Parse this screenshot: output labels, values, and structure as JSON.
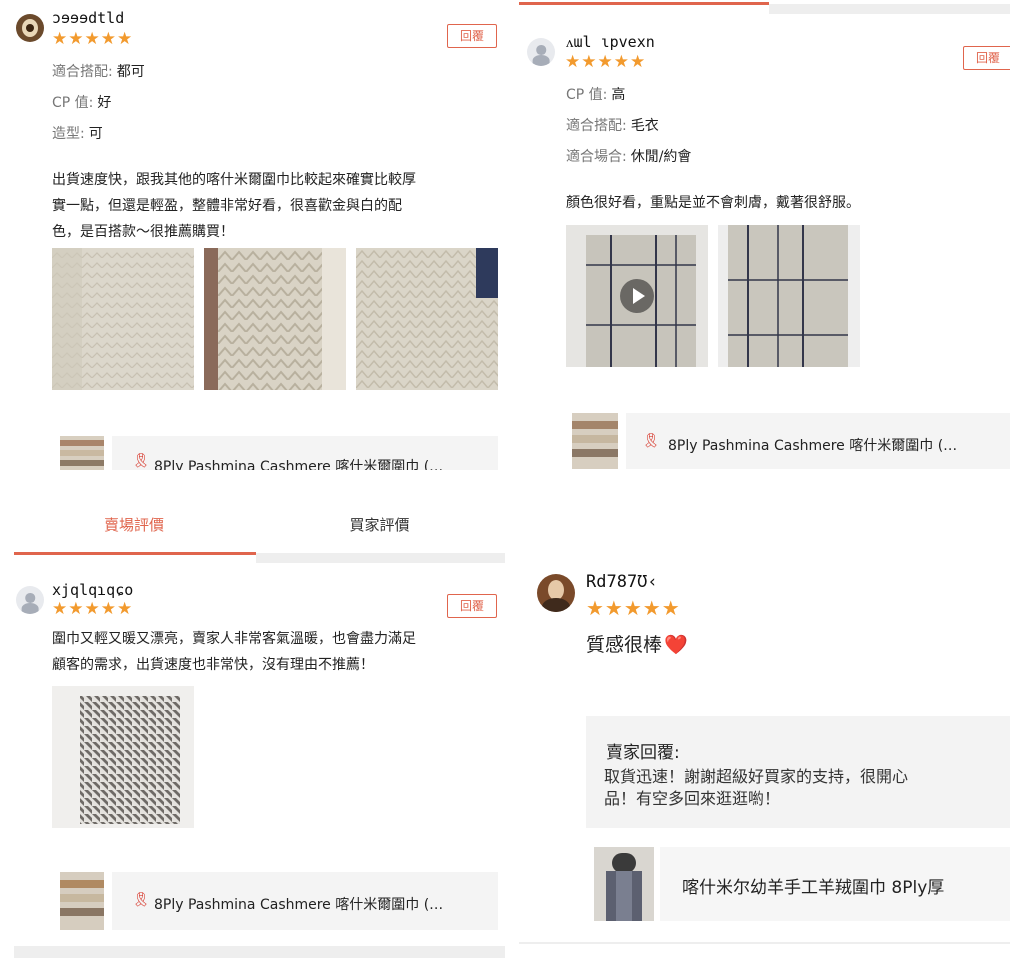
{
  "reply_label": "回覆",
  "star_glyphs": "★★★★★",
  "accent_color": "#e0654d",
  "star_color": "#f29a2e",
  "review1": {
    "username": "ɔɘɘɘdtld",
    "attrs": [
      {
        "label": "適合搭配:",
        "value": "都可"
      },
      {
        "label": "CP 值:",
        "value": "好"
      },
      {
        "label": "造型:",
        "value": "可"
      }
    ],
    "text_lines": [
      "出貨速度快，跟我其他的喀什米爾圍巾比較起來確實比較厚",
      "實一點，但還是輕盈，整體非常好看，很喜歡金與白的配",
      "色，是百搭款～很推薦購買！"
    ],
    "product_name": "8Ply Pashmina Cashmere 喀什米爾圍巾 (…"
  },
  "review2": {
    "username": "ᴧɯl ɩpvexn",
    "attrs": [
      {
        "label": "CP 值:",
        "value": "高"
      },
      {
        "label": "適合搭配:",
        "value": "毛衣"
      },
      {
        "label": "適合場合:",
        "value": "休閒/約會"
      }
    ],
    "text": "顏色很好看，重點是並不會刺膚，戴著很舒服。",
    "product_name": "8Ply Pashmina Cashmere 喀什米爾圍巾 (…"
  },
  "tabs": {
    "shop": "賣場評價",
    "buyer": "買家評價"
  },
  "review3": {
    "username": "xjqlqɿqɕo",
    "text_lines": [
      "圍巾又輕又暖又漂亮，賣家人非常客氣溫暖，也會盡力滿足",
      "顧客的需求，出貨速度也非常快，沒有理由不推薦！"
    ],
    "product_name": "8Ply Pashmina Cashmere 喀什米爾圍巾 (…"
  },
  "review4": {
    "username": "Rd787Ʊ‹",
    "text": "質感很棒",
    "heart": "❤️",
    "seller_reply_title": "賣家回覆:",
    "seller_reply_lines": [
      "取貨迅速！謝謝超級好買家的支持，很開心",
      "品！有空多回來逛逛喲！"
    ],
    "product_name": "喀什米尔幼羊手工羊羢圍巾 8Ply厚"
  }
}
